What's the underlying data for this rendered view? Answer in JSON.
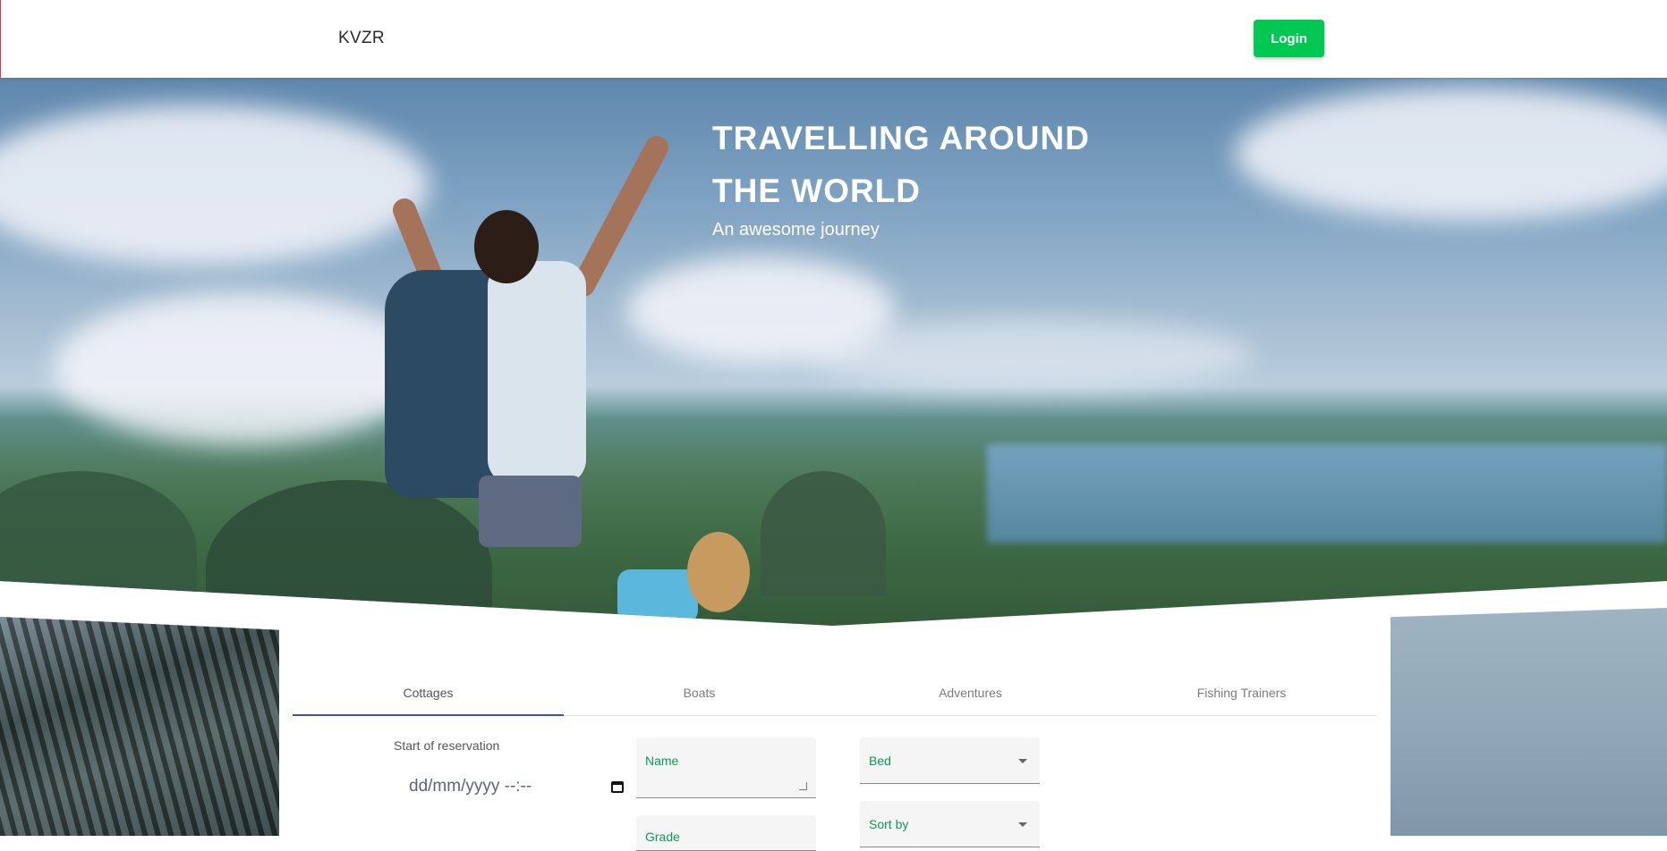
{
  "navbar": {
    "brand": "KVZR",
    "login_label": "Login"
  },
  "hero": {
    "title_line1": "TRAVELLING AROUND",
    "title_line2": "THE WORLD",
    "subtitle": "An awesome journey"
  },
  "tabs": [
    {
      "label": "Cottages",
      "active": true
    },
    {
      "label": "Boats",
      "active": false
    },
    {
      "label": "Adventures",
      "active": false
    },
    {
      "label": "Fishing Trainers",
      "active": false
    }
  ],
  "filters": {
    "start_label": "Start of reservation",
    "date_placeholder": "dd/mm/yyyy --:--",
    "name_label": "Name",
    "grade_label": "Grade",
    "bed_label": "Bed",
    "sort_label": "Sort by"
  },
  "colors": {
    "accent_green": "#00c853",
    "label_green": "#0a9a58",
    "tab_indicator": "#3f51b5"
  },
  "icons": {
    "calendar": "calendar-icon",
    "dropdown": "chevron-down-icon",
    "resize": "resize-handle-icon"
  }
}
